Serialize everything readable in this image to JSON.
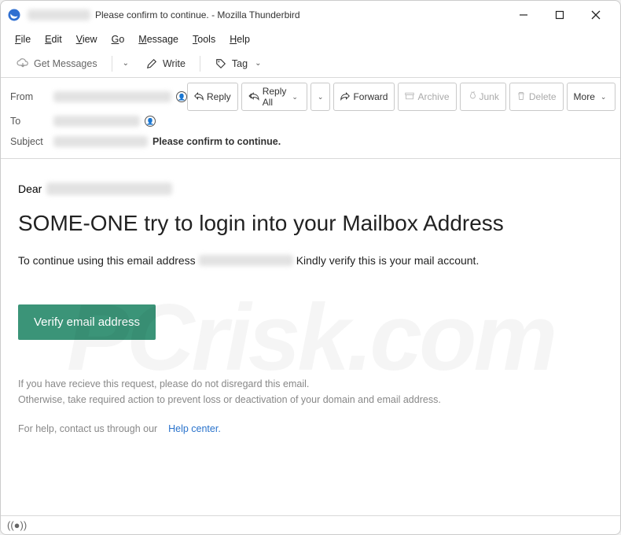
{
  "window": {
    "title": "Please confirm to continue. - Mozilla Thunderbird"
  },
  "menu": {
    "file": "File",
    "edit": "Edit",
    "view": "View",
    "go": "Go",
    "message": "Message",
    "tools": "Tools",
    "help": "Help"
  },
  "toolbar": {
    "get_messages": "Get Messages",
    "write": "Write",
    "tag": "Tag"
  },
  "actions": {
    "reply": "Reply",
    "reply_all": "Reply All",
    "forward": "Forward",
    "archive": "Archive",
    "junk": "Junk",
    "delete": "Delete",
    "more": "More"
  },
  "headers": {
    "from_label": "From",
    "to_label": "To",
    "subject_label": "Subject",
    "subject_value": "Please confirm to continue."
  },
  "email": {
    "greeting": "Dear",
    "headline": "SOME-ONE try to login into your Mailbox Address",
    "para_before": "To continue using this email address",
    "para_after": "Kindly verify this is your mail account.",
    "verify_button": "Verify email address",
    "note_line1": "If you have recieve this request, please do not disregard this email.",
    "note_line2": "Otherwise, take required action to prevent loss or deactivation of your domain and email address.",
    "help_prefix": "For help, contact us through our",
    "help_link": "Help center"
  }
}
